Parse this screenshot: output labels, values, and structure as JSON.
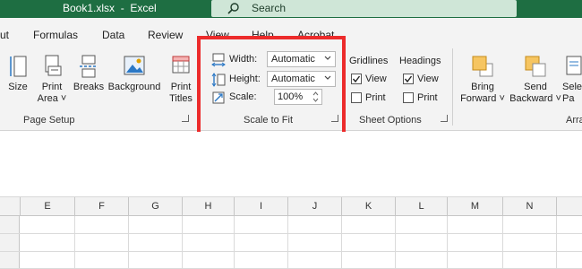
{
  "window": {
    "title": "Book1.xlsx  -  Excel"
  },
  "search": {
    "label": "Search"
  },
  "tabs": [
    "ut",
    "Formulas",
    "Data",
    "Review",
    "View",
    "Help",
    "Acrobat"
  ],
  "page_setup": {
    "size": "Size",
    "print_area": [
      "Print",
      "Area ˅"
    ],
    "breaks": "Breaks",
    "background": "Background",
    "print_titles": [
      "Print",
      "Titles"
    ],
    "group_label": "Page Setup"
  },
  "scale_to_fit": {
    "width_label": "Width:",
    "width_value": "Automatic",
    "height_label": "Height:",
    "height_value": "Automatic",
    "scale_label": "Scale:",
    "scale_value": "100%",
    "group_label": "Scale to Fit"
  },
  "sheet_options": {
    "gridlines": "Gridlines",
    "headings": "Headings",
    "view": "View",
    "print": "Print",
    "gridlines_view_checked": true,
    "gridlines_print_checked": false,
    "headings_view_checked": true,
    "headings_print_checked": false,
    "group_label": "Sheet Options"
  },
  "arrange": {
    "bring_forward": [
      "Bring",
      "Forward ˅"
    ],
    "send_backward": [
      "Send",
      "Backward ˅"
    ],
    "selection_pane": [
      "Sele",
      "Pa"
    ],
    "group_label": "Arra"
  },
  "columns": [
    "E",
    "F",
    "G",
    "H",
    "I",
    "J",
    "K",
    "L",
    "M",
    "N"
  ],
  "colors": {
    "accent": "#1e6e42",
    "highlight": "#ec2b2b"
  }
}
